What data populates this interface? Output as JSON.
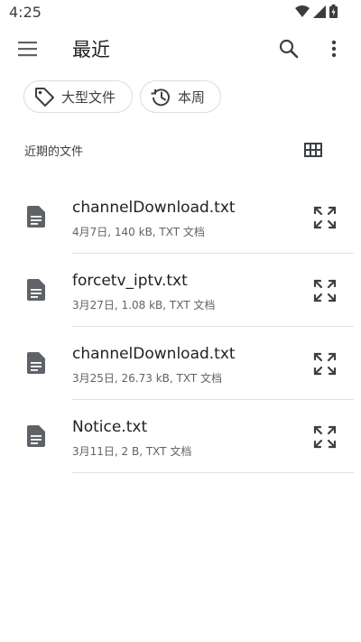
{
  "status_bar": {
    "time": "4:25"
  },
  "app_bar": {
    "title": "最近"
  },
  "chips": {
    "large_files": "大型文件",
    "this_week": "本周"
  },
  "section": {
    "title": "近期的文件"
  },
  "files": [
    {
      "name": "channelDownload.txt",
      "meta": "4月7日, 140 kB, TXT 文档"
    },
    {
      "name": "forcetv_iptv.txt",
      "meta": "3月27日, 1.08 kB, TXT 文档"
    },
    {
      "name": "channelDownload.txt",
      "meta": "3月25日, 26.73 kB, TXT 文档"
    },
    {
      "name": "Notice.txt",
      "meta": "3月11日, 2 B, TXT 文档"
    }
  ],
  "colors": {
    "icon": "#5f6368",
    "divider": "#e0e0e0",
    "chip_border": "#dadce0"
  }
}
